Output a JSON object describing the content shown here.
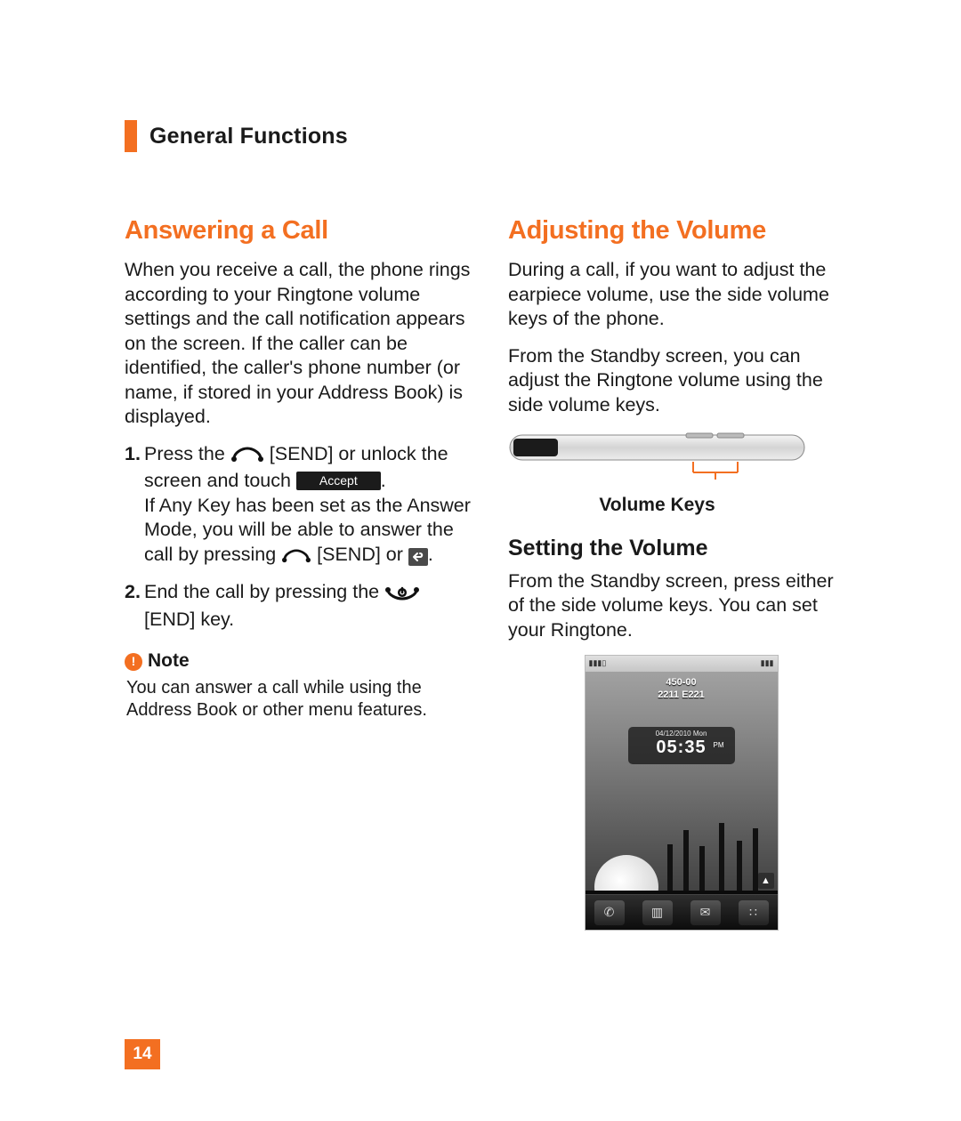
{
  "chapter": {
    "title": "General Functions"
  },
  "page_number": "14",
  "left": {
    "heading": "Answering a Call",
    "intro": "When you receive a call, the phone rings according to your Ringtone volume settings and the call notification appears on the screen. If the caller can be identified, the caller's phone number (or name, if stored in your Address Book) is displayed.",
    "step1_num": "1.",
    "step1_a": "Press the ",
    "step1_b": "[SEND] or unlock the screen and touch ",
    "accept_label": "Accept",
    "step1_c": ".",
    "step1_d": "If Any Key has been set as the Answer Mode, you will be able to answer the call by pressing ",
    "step1_e": " [SEND] or ",
    "step1_f": ".",
    "step2_num": "2.",
    "step2_a": "End the call by pressing the ",
    "step2_b": "[END] key.",
    "note_label": "Note",
    "note_text": "You can answer a call while using the Address Book or other menu features."
  },
  "right": {
    "heading": "Adjusting the Volume",
    "p1": "During a call, if you want to adjust the earpiece volume, use the side volume keys of the phone.",
    "p2": "From the Standby screen, you can adjust the Ringtone volume using the side volume keys.",
    "volume_keys_label": "Volume Keys",
    "sub_heading": "Setting the Volume",
    "p3": "From the Standby screen, press either of the side volume keys. You can set your Ringtone.",
    "phone": {
      "carrier_line1": "450-00",
      "carrier_line2": "2211 E221",
      "date": "04/12/2010 Mon",
      "time": "05:35",
      "ampm": "PM"
    }
  }
}
